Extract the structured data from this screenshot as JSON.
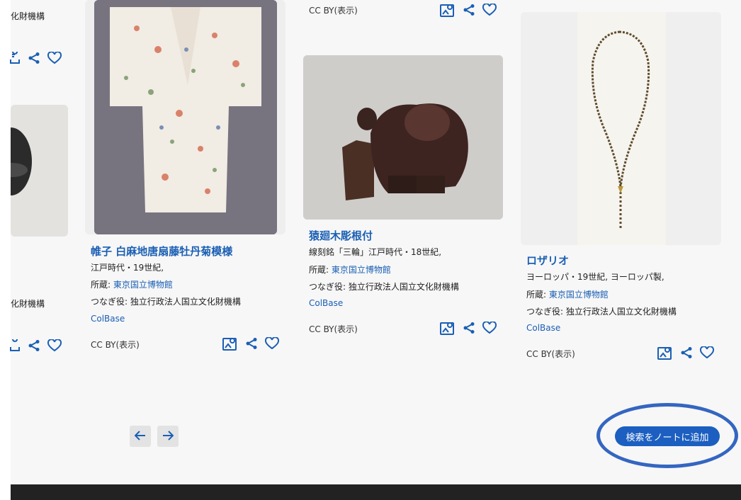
{
  "partial_col": {
    "org_top": "化財機構",
    "org_mid": "化財機構"
  },
  "col2": {
    "title": "帷子 白麻地唐扇藤牡丹菊模様",
    "line1": "江戸時代・19世紀,",
    "owner_label": "所蔵: ",
    "owner": "東京国立博物館",
    "mediator": "つなぎ役: 独立行政法人国立文化財機構",
    "source": "ColBase",
    "license": "CC BY(表示)"
  },
  "col3": {
    "top_license": "CC BY(表示)",
    "title": "猿廻木彫根付",
    "line1": "線刻銘「三輪」江戸時代・18世紀,",
    "owner_label": "所蔵: ",
    "owner": "東京国立博物館",
    "mediator": "つなぎ役: 独立行政法人国立文化財機構",
    "source": "ColBase",
    "license": "CC BY(表示)"
  },
  "col4": {
    "title": "ロザリオ",
    "line1": "ヨーロッパ・19世紀, ヨーロッパ製,",
    "owner_label": "所蔵: ",
    "owner": "東京国立博物館",
    "mediator": "つなぎ役: 独立行政法人国立文化財機構",
    "source": "ColBase",
    "license": "CC BY(表示)"
  },
  "pagination": {
    "prev_icon": "arrow-left-icon",
    "next_icon": "arrow-right-icon"
  },
  "add_to_note_label": "検索をノートに追加",
  "icons": {
    "image_search": "image-search-icon",
    "share": "share-icon",
    "favorite": "heart-icon"
  },
  "colors": {
    "accent": "#1a5fb4",
    "button": "#1c5fc0",
    "highlight": "#3466c1",
    "footer": "#222222"
  }
}
